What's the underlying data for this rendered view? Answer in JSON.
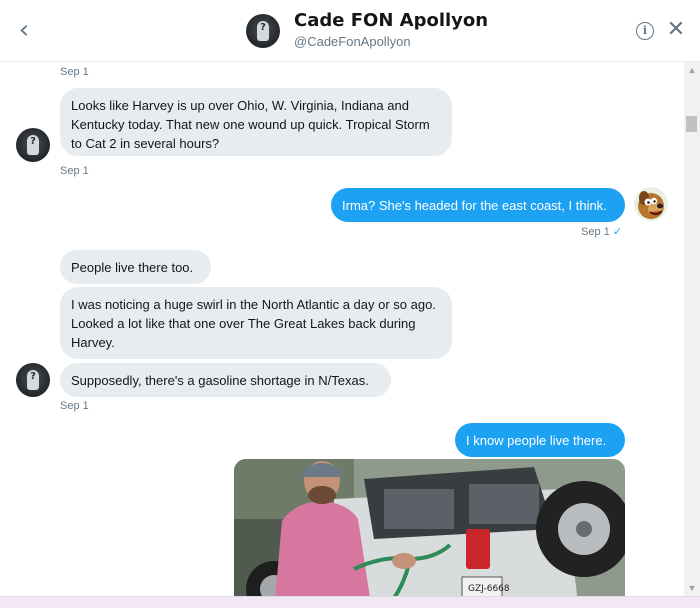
{
  "header": {
    "back_icon": "chevron-left-icon",
    "name": "Cade FON Apollyon",
    "handle": "@CadeFonApollyon",
    "info_icon": "info-circle-icon",
    "close_icon": "close-icon"
  },
  "messages": [
    {
      "direction": "received",
      "timestamp": "Sep 1"
    },
    {
      "direction": "received",
      "text": "Looks like Harvey is up over Ohio, W. Virginia, Indiana and Kentucky today. That new one wound up quick. Tropical Storm to Cat 2 in several hours?",
      "timestamp": "Sep 1"
    },
    {
      "direction": "sent",
      "text": "Irma? She's headed for the east coast, I think.",
      "timestamp": "Sep 1",
      "status": "✓"
    },
    {
      "direction": "received",
      "text": "People live there too."
    },
    {
      "direction": "received",
      "text": "I was noticing a huge swirl in the North Atlantic a day or so ago. Looked a  lot like that one over The Great Lakes back during Harvey."
    },
    {
      "direction": "received",
      "text": "Supposedly, there's a gasoline shortage in N/Texas.",
      "timestamp": "Sep 1"
    },
    {
      "direction": "sent",
      "text": "I know people live there."
    },
    {
      "direction": "sent",
      "media": "photo",
      "media_plate": "GZJ-6668"
    }
  ],
  "scrollbar": {
    "up_icon": "triangle-up-icon",
    "down_icon": "triangle-down-icon"
  },
  "colors": {
    "sent_bubble": "#1da1f2",
    "received_bubble": "#e6ecf0",
    "meta_text": "#657786"
  }
}
